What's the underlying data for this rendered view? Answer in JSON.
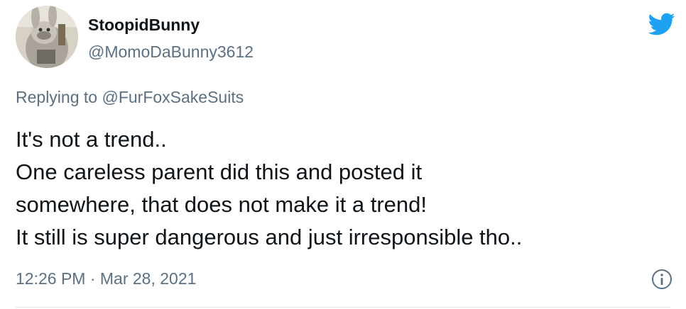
{
  "author": {
    "display_name": "StoopidBunny",
    "handle": "@MomoDaBunny3612"
  },
  "reply": {
    "prefix": "Replying to",
    "to_handle": "@FurFoxSakeSuits"
  },
  "tweet": {
    "lines": [
      "It's not a trend..",
      "One careless parent did this and posted it",
      "somewhere, that does not make it a trend!",
      "It still is super dangerous and just irresponsible tho.."
    ]
  },
  "meta": {
    "timestamp": "12:26 PM · Mar 28, 2021"
  },
  "icons": {
    "brand": "twitter-bird-icon",
    "info": "info-icon"
  },
  "colors": {
    "brand_blue": "#1da1f2",
    "secondary_text": "#5b7083",
    "primary_text": "#0f1419",
    "divider": "#e1e8ed"
  }
}
